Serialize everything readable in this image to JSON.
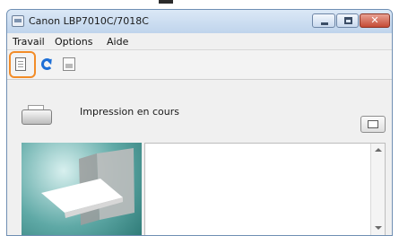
{
  "window": {
    "title": "Canon LBP7010C/7018C",
    "controls": {
      "minimize_icon": "minimize-icon",
      "maximize_icon": "maximize-icon",
      "close_icon": "close-icon",
      "close_glyph": "✕"
    }
  },
  "menu": {
    "items": [
      {
        "label": "Travail"
      },
      {
        "label": "Options"
      },
      {
        "label": "Aide"
      }
    ]
  },
  "toolbar": {
    "icons": [
      "document-icon",
      "refresh-icon",
      "print-icon"
    ],
    "highlight_color": "#f28c28"
  },
  "status": {
    "printer_icon": "printer-icon",
    "text": "Impression en cours"
  },
  "colors": {
    "title_bar": "#bfd4ec",
    "close_button": "#c44a35",
    "preview_teal": "#5fa9a6"
  }
}
